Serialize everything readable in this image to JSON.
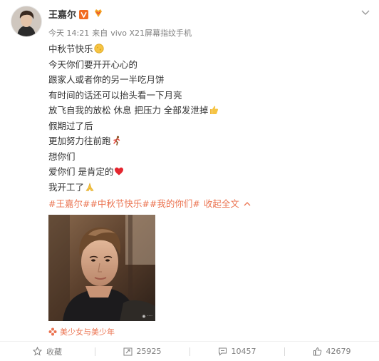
{
  "user": {
    "name": "王嘉尔"
  },
  "post": {
    "time": "今天 14:21",
    "via_prefix": "来自",
    "device": "vivo X21屏幕指纹手机",
    "lines": [
      "中秋节快乐",
      "今天你们要开开心心的",
      "跟家人或者你的另一半吃月饼",
      "有时间的话还可以抬头看一下月亮",
      "放飞自我的放松 休息 把压力 全部发泄掉",
      "假期过了后",
      "更加努力往前跑",
      "想你们",
      "爱你们 是肯定的",
      "我开工了"
    ],
    "tags": [
      "#王嘉尔#",
      "#中秋节快乐#",
      "#我的你们#"
    ],
    "collapse_label": "收起全文",
    "source": "美少女与美少年"
  },
  "actions": {
    "favorite": "收藏",
    "repost": "25925",
    "comment": "10457",
    "like": "42679"
  },
  "icons": {
    "vip": "weibo-verified-v-icon",
    "badge": "fan-badge-icon",
    "more": "chevron-down-icon",
    "moon": "moon-emoji-icon",
    "thumbs": "thumbs-up-emoji-icon",
    "runner": "running-emoji-icon",
    "heart": "heart-emoji-icon",
    "pray": "pray-emoji-icon",
    "source": "flower-icon",
    "favorite": "star-icon",
    "repost": "repost-icon",
    "comment": "comment-icon",
    "like": "like-icon"
  },
  "colors": {
    "link": "#eb7350",
    "meta": "#808080",
    "text": "#333333",
    "vip": "#f26b21"
  }
}
